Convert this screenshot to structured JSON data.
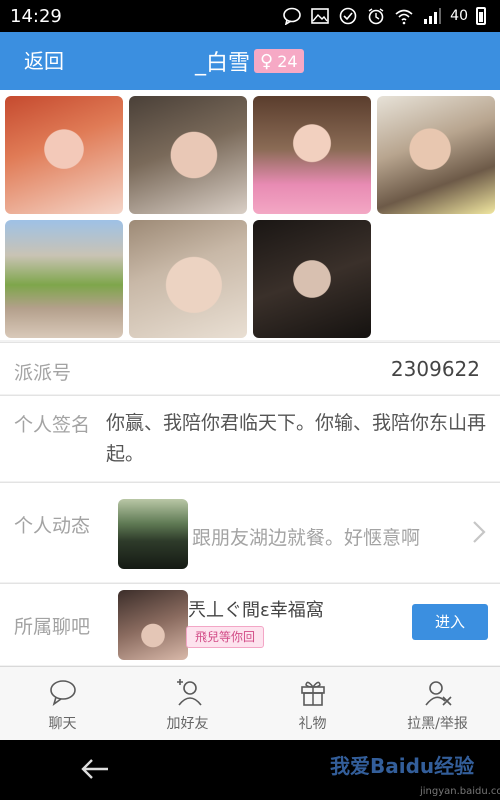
{
  "status_bar": {
    "time": "14:29",
    "battery": "40"
  },
  "header": {
    "back_label": "返回",
    "title": "_白雪",
    "gender_symbol": "♀",
    "age": "24"
  },
  "profile": {
    "id_label": "派派号",
    "id_value": "2309622",
    "signature_label": "个人签名",
    "signature_text": "你赢、我陪你君临天下。你输、我陪你东山再起。",
    "feed_label": "个人动态",
    "feed_text": "跟朋友湖边就餐。好惬意啊",
    "chat_label": "所属聊吧",
    "chat_name": "兲丄ぐ間ε幸福窩",
    "chat_tag": "飛兒等你回",
    "enter_label": "进入"
  },
  "actions": [
    {
      "label": "聊天",
      "icon": "chat-bubble-icon"
    },
    {
      "label": "加好友",
      "icon": "add-friend-icon"
    },
    {
      "label": "礼物",
      "icon": "gift-icon"
    },
    {
      "label": "拉黑/举报",
      "icon": "block-report-icon"
    }
  ],
  "watermark": {
    "text": "我爱Baidu经验",
    "sub": "jingyan.baidu.com"
  },
  "colors": {
    "accent": "#3b8fe0",
    "badge": "#f6a9c5"
  }
}
